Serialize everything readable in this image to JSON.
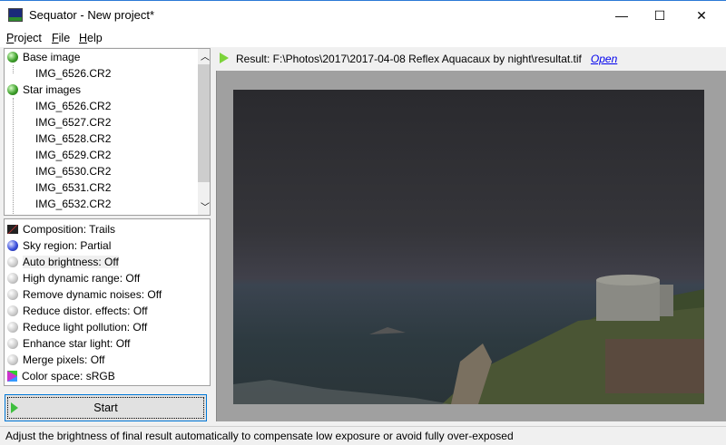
{
  "window": {
    "title": "Sequator - New project*",
    "minimize": "—",
    "maximize": "☐",
    "close": "✕"
  },
  "menu": [
    {
      "label": "Project",
      "key": "P",
      "rest": "roject"
    },
    {
      "label": "File",
      "key": "F",
      "rest": "ile"
    },
    {
      "label": "Help",
      "key": "H",
      "rest": "elp"
    }
  ],
  "tree": {
    "base_label": "Base image",
    "base_file": "IMG_6526.CR2",
    "star_label": "Star images",
    "star_files": [
      "IMG_6526.CR2",
      "IMG_6527.CR2",
      "IMG_6528.CR2",
      "IMG_6529.CR2",
      "IMG_6530.CR2",
      "IMG_6531.CR2",
      "IMG_6532.CR2"
    ]
  },
  "options": [
    "Composition: Trails",
    "Sky region: Partial",
    "Auto brightness: Off",
    "High dynamic range: Off",
    "Remove dynamic noises: Off",
    "Reduce distor. effects: Off",
    "Reduce light pollution: Off",
    "Enhance star light: Off",
    "Merge pixels: Off",
    "Color space: sRGB"
  ],
  "start_label": "Start",
  "result": {
    "text": "Result: F:\\Photos\\2017\\2017-04-08 Reflex Aquacaux by night\\resultat.tif",
    "open_label": "Open"
  },
  "status": "Adjust the brightness of final result automatically to compensate low exposure or avoid fully over-exposed"
}
